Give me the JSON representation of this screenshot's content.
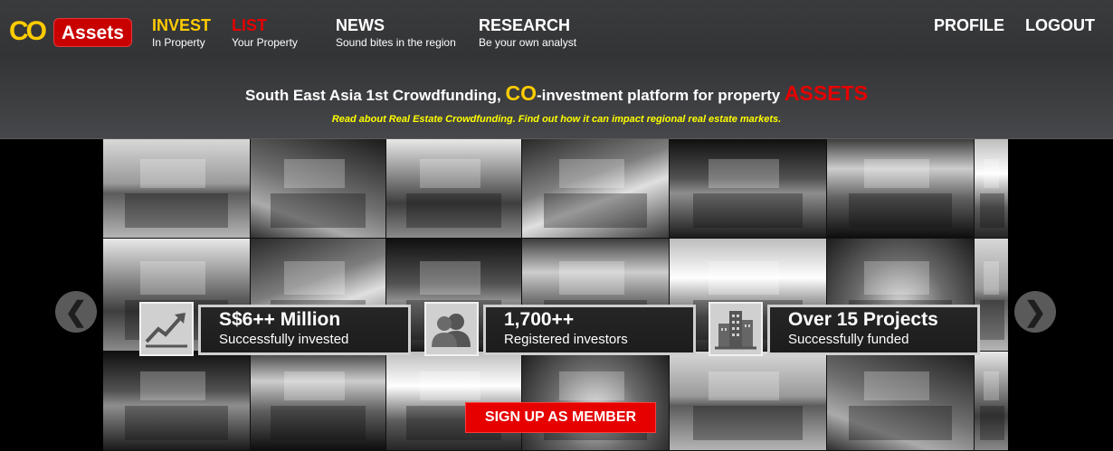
{
  "logo": {
    "co": "CO",
    "assets": "Assets"
  },
  "nav": {
    "invest": {
      "title": "INVEST",
      "sub": "In Property"
    },
    "list": {
      "title": "LIST",
      "sub": "Your Property"
    },
    "news": {
      "title": "NEWS",
      "sub": "Sound bites in the region"
    },
    "research": {
      "title": "RESEARCH",
      "sub": "Be your own analyst"
    },
    "profile": "PROFILE",
    "logout": "LOGOUT"
  },
  "tagline": {
    "part1": "South East Asia 1st Crowdfunding, ",
    "co": "CO",
    "part2": "-investment platform for property ",
    "assets": "ASSETS"
  },
  "subtagline": "Read about Real Estate Crowdfunding. Find out how it can impact regional real estate markets.",
  "stats": [
    {
      "icon": "chart-up-icon",
      "value": "S$6++ Million",
      "label": "Successfully invested"
    },
    {
      "icon": "users-icon",
      "value": "1,700++",
      "label": "Registered investors"
    },
    {
      "icon": "buildings-icon",
      "value": "Over 15 Projects",
      "label": "Successfully funded"
    }
  ],
  "signup_label": "SIGN UP AS MEMBER",
  "colors": {
    "yellow": "#ffcc00",
    "red": "#e60000",
    "header_bg": "#3a3b3d"
  }
}
